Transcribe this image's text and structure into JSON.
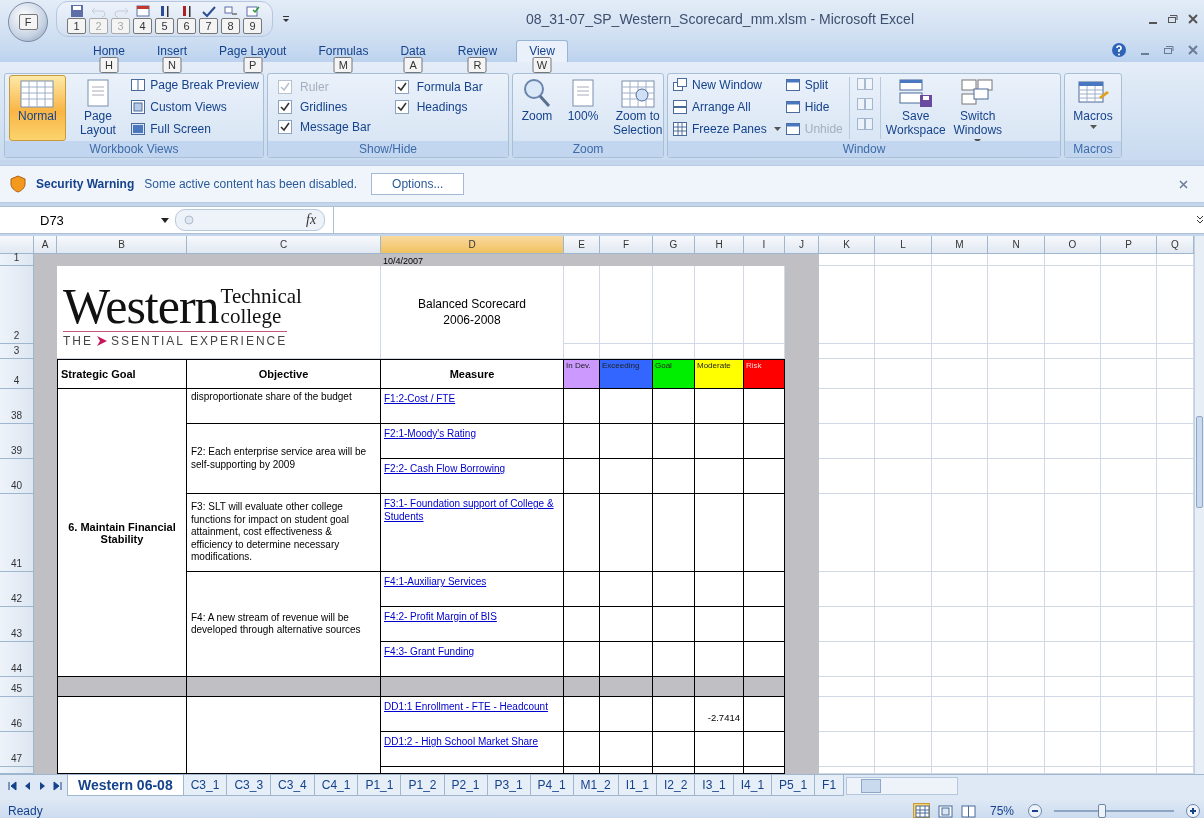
{
  "title_bar": {
    "office_keytip": "F",
    "quick_access": [
      {
        "keytip": "1",
        "disabled": false
      },
      {
        "keytip": "2",
        "disabled": true
      },
      {
        "keytip": "3",
        "disabled": true
      },
      {
        "keytip": "4",
        "disabled": false
      },
      {
        "keytip": "5",
        "disabled": false
      },
      {
        "keytip": "6",
        "disabled": false
      },
      {
        "keytip": "7",
        "disabled": false
      },
      {
        "keytip": "8",
        "disabled": false
      },
      {
        "keytip": "9",
        "disabled": false
      }
    ],
    "title": "08_31-07_SP_Western_Scorecard_mm.xlsm - Microsoft Excel"
  },
  "tabs": [
    {
      "label": "Home",
      "keytip": "H",
      "selected": false
    },
    {
      "label": "Insert",
      "keytip": "N",
      "selected": false
    },
    {
      "label": "Page Layout",
      "keytip": "P",
      "selected": false
    },
    {
      "label": "Formulas",
      "keytip": "M",
      "selected": false
    },
    {
      "label": "Data",
      "keytip": "A",
      "selected": false
    },
    {
      "label": "Review",
      "keytip": "R",
      "selected": false
    },
    {
      "label": "View",
      "keytip": "W",
      "selected": true
    }
  ],
  "ribbon": {
    "groups": [
      {
        "kind": "views",
        "title": "Workbook Views",
        "items": [
          {
            "label": "Normal",
            "selected": true
          },
          {
            "label": "Page Layout",
            "selected": false
          },
          {
            "label": "Page Break Preview"
          },
          {
            "label": "Custom Views"
          },
          {
            "label": "Full Screen"
          }
        ]
      },
      {
        "kind": "show_hide",
        "title": "Show/Hide",
        "items": [
          {
            "label": "Ruler",
            "checked": true,
            "disabled": true
          },
          {
            "label": "Gridlines",
            "checked": true,
            "disabled": false
          },
          {
            "label": "Message Bar",
            "checked": true,
            "disabled": false
          },
          {
            "label": "Formula Bar",
            "checked": true,
            "disabled": false
          },
          {
            "label": "Headings",
            "checked": true,
            "disabled": false
          }
        ]
      },
      {
        "kind": "zoom",
        "title": "Zoom",
        "items": [
          {
            "label": "Zoom"
          },
          {
            "label": "100%"
          },
          {
            "label": "Zoom to Selection"
          }
        ]
      },
      {
        "kind": "window",
        "title": "Window",
        "items": [
          {
            "label": "New Window",
            "dropdown": false,
            "disabled": false
          },
          {
            "label": "Arrange All",
            "dropdown": false,
            "disabled": false
          },
          {
            "label": "Freeze Panes",
            "dropdown": true,
            "disabled": false
          },
          {
            "label": "Split",
            "dropdown": false,
            "disabled": false
          },
          {
            "label": "Hide",
            "dropdown": false,
            "disabled": false
          },
          {
            "label": "Unhide",
            "dropdown": false,
            "disabled": true
          },
          {
            "label": "Save Workspace",
            "dropdown": false,
            "disabled": false
          },
          {
            "label": "Switch Windows",
            "dropdown": true,
            "disabled": false
          }
        ],
        "icon_buttons": [
          {
            "disabled": true
          },
          {
            "disabled": true
          },
          {
            "disabled": true
          }
        ]
      },
      {
        "kind": "macros",
        "title": "Macros",
        "items": [
          {
            "label": "Macros",
            "dropdown": true
          }
        ]
      }
    ]
  },
  "security_bar": {
    "title": "Security Warning",
    "message": "Some active content has been disabled.",
    "button": "Options..."
  },
  "formula_bar": {
    "name_box": "D73",
    "fx": "fx"
  },
  "columns": [
    {
      "label": "A",
      "selected": false
    },
    {
      "label": "B",
      "selected": false
    },
    {
      "label": "C",
      "selected": false
    },
    {
      "label": "D",
      "selected": true
    },
    {
      "label": "E",
      "selected": false
    },
    {
      "label": "F",
      "selected": false
    },
    {
      "label": "G",
      "selected": false
    },
    {
      "label": "H",
      "selected": false
    },
    {
      "label": "I",
      "selected": false
    },
    {
      "label": "J",
      "selected": false
    },
    {
      "label": "K",
      "selected": false
    },
    {
      "label": "L",
      "selected": false
    },
    {
      "label": "M",
      "selected": false
    },
    {
      "label": "N",
      "selected": false
    },
    {
      "label": "O",
      "selected": false
    },
    {
      "label": "P",
      "selected": false
    },
    {
      "label": "Q",
      "selected": false
    }
  ],
  "rows": [
    "1",
    "2",
    "3",
    "4",
    "38",
    "39",
    "40",
    "41",
    "42",
    "43",
    "44",
    "45",
    "46",
    "47"
  ],
  "sheet": {
    "date": "10/4/2007",
    "logo": {
      "name": "Western",
      "line1": "Technical",
      "line2": "college",
      "prefix": "THE",
      "tagline": "SSENTIAL EXPERIENCE"
    },
    "title": "Balanced Scorecard",
    "subtitle": "2006-2008",
    "headers": {
      "goal": "Strategic Goal",
      "objective": "Objective",
      "measure": "Measure"
    },
    "legend": [
      {
        "kind": "in_dev",
        "label": "In Dev.",
        "color": "#cc99ff"
      },
      {
        "kind": "exceeding",
        "label": "Exceeding",
        "color": "#3366ff"
      },
      {
        "kind": "goal",
        "label": "Goal",
        "color": "#00ee00"
      },
      {
        "kind": "moderate",
        "label": "Moderate",
        "color": "#ffff00"
      },
      {
        "kind": "risk",
        "label": "Risk",
        "color": "#ff0000"
      }
    ],
    "sections": [
      {
        "goal": "6. Maintain Financial Stability",
        "objectives": [
          {
            "text": "disproportionate share of the budget",
            "measures": [
              {
                "label": "F1:2-Cost / FTE"
              }
            ]
          },
          {
            "text": "F2: Each enterprise service area will be self-supporting by 2009",
            "measures": [
              {
                "label": "F2:1-Moody's Rating"
              },
              {
                "label": "F2:2- Cash Flow Borrowing"
              }
            ]
          },
          {
            "text": "F3: SLT will evaluate other college functions for impact on student goal attainment, cost effectiveness & efficiency to determine necessary modifications.",
            "measures": [
              {
                "label": "F3:1- Foundation support of College & Students"
              }
            ]
          },
          {
            "text": "F4: A new stream of revenue will be developed through alternative sources",
            "measures": [
              {
                "label": "F4:1-Auxiliary Services"
              },
              {
                "label": "F4:2- Profit Margin of BIS"
              },
              {
                "label": "F4:3- Grant Funding"
              }
            ]
          }
        ]
      },
      {
        "objectives": [
          {
            "measures": [
              {
                "label": "DD1:1 Enrollment - FTE - Headcount",
                "moderate": "-2.7414"
              },
              {
                "label": "DD1:2 - High School Market Share"
              }
            ]
          }
        ]
      }
    ]
  },
  "sheet_tabs": [
    {
      "label": "Western 06-08",
      "selected": true
    },
    {
      "label": "C3_1",
      "selected": false
    },
    {
      "label": "C3_3",
      "selected": false
    },
    {
      "label": "C3_4",
      "selected": false
    },
    {
      "label": "C4_1",
      "selected": false
    },
    {
      "label": "P1_1",
      "selected": false
    },
    {
      "label": "P1_2",
      "selected": false
    },
    {
      "label": "P2_1",
      "selected": false
    },
    {
      "label": "P3_1",
      "selected": false
    },
    {
      "label": "P4_1",
      "selected": false
    },
    {
      "label": "M1_2",
      "selected": false
    },
    {
      "label": "I1_1",
      "selected": false
    },
    {
      "label": "I2_2",
      "selected": false
    },
    {
      "label": "I3_1",
      "selected": false
    },
    {
      "label": "I4_1",
      "selected": false
    },
    {
      "label": "P5_1",
      "selected": false
    },
    {
      "label": "F1",
      "selected": false
    }
  ],
  "status_bar": {
    "status": "Ready",
    "views": [
      {
        "selected": true
      },
      {
        "selected": false
      },
      {
        "selected": false
      }
    ],
    "zoom": "75%",
    "level": 0.4
  }
}
